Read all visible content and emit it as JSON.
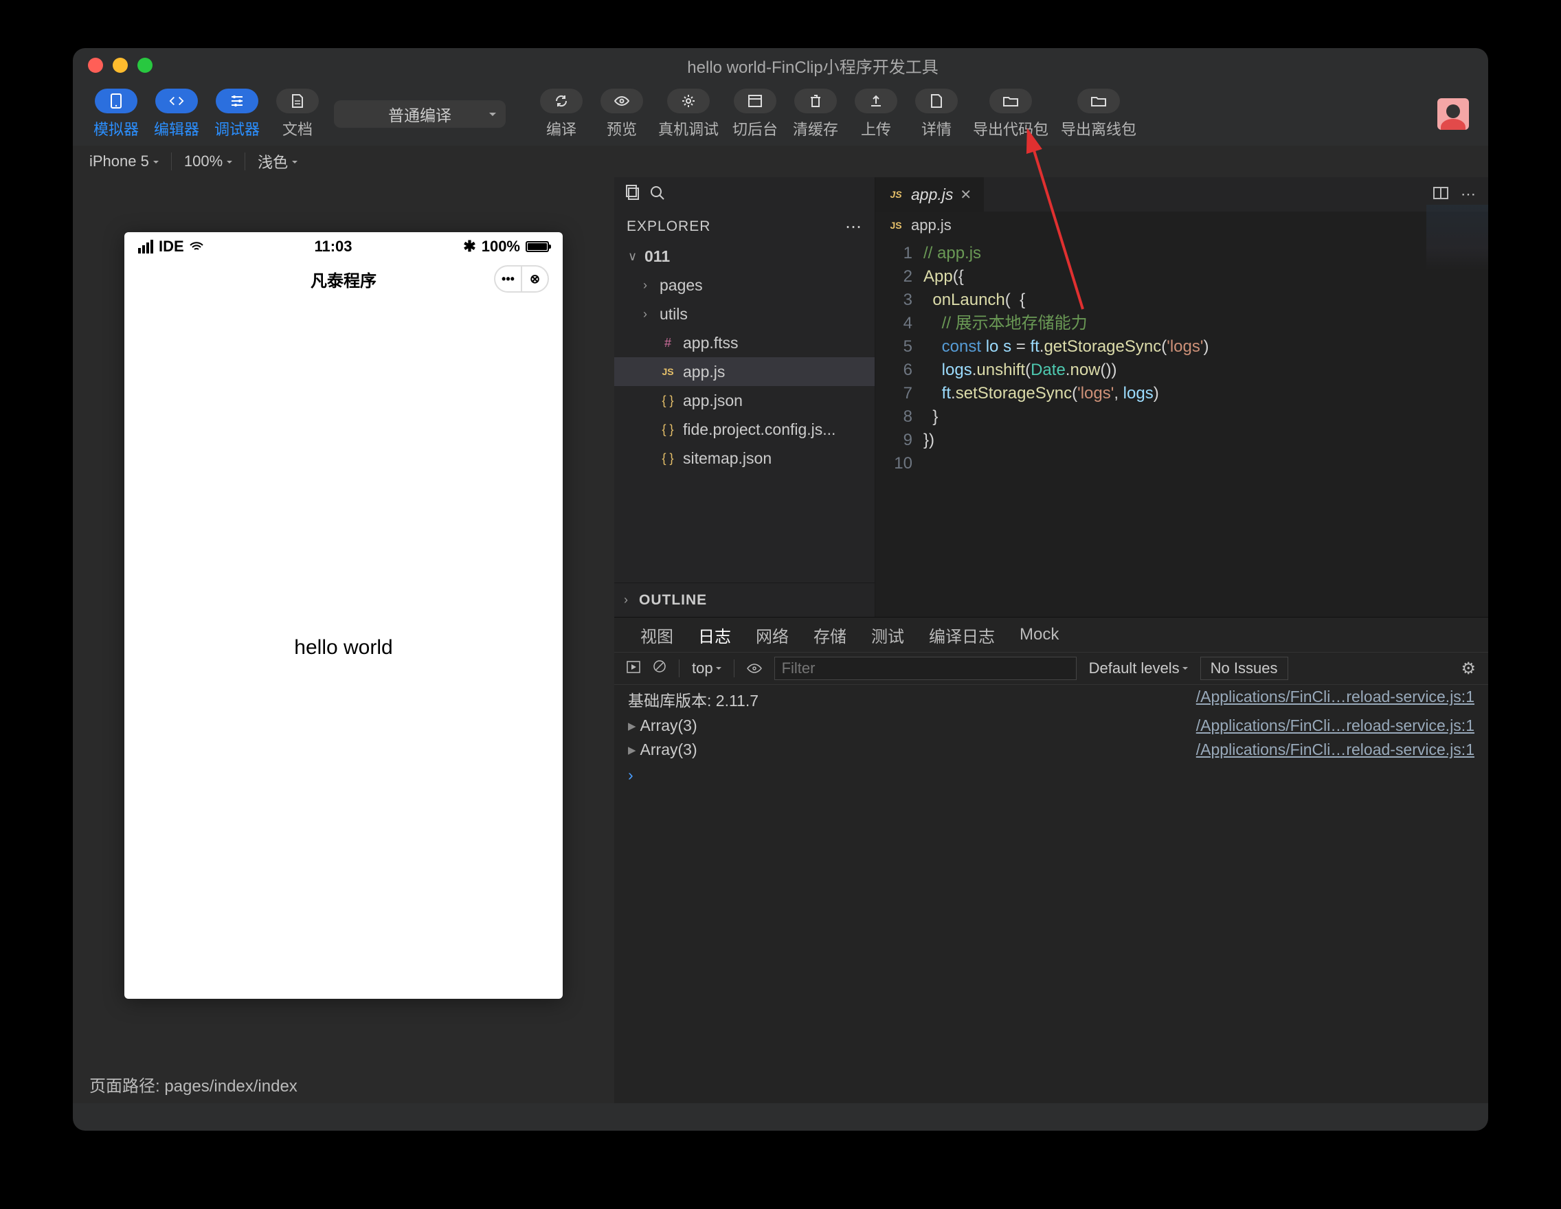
{
  "title": "hello world-FinClip小程序开发工具",
  "toolbar": {
    "simulator": "模拟器",
    "editor": "编辑器",
    "debugger": "调试器",
    "docs": "文档",
    "compileMode": "普通编译",
    "compile": "编译",
    "preview": "预览",
    "realDevice": "真机调试",
    "background": "切后台",
    "clearCache": "清缓存",
    "upload": "上传",
    "details": "详情",
    "exportCode": "导出代码包",
    "exportOffline": "导出离线包"
  },
  "subbar": {
    "device": "iPhone 5",
    "zoom": "100%",
    "theme": "浅色"
  },
  "phone": {
    "carrier": "IDE",
    "time": "11:03",
    "battery": "100%",
    "navTitle": "凡泰程序",
    "body": "hello world",
    "pagePath": "页面路径: pages/index/index"
  },
  "explorer": {
    "title": "EXPLORER",
    "root": "011",
    "items": [
      {
        "icon": ">",
        "label": "pages",
        "type": "folder"
      },
      {
        "icon": ">",
        "label": "utils",
        "type": "folder"
      },
      {
        "icon": "ft",
        "label": "app.ftss",
        "type": "ft"
      },
      {
        "icon": "JS",
        "label": "app.js",
        "type": "js",
        "selected": true
      },
      {
        "icon": "{}",
        "label": "app.json",
        "type": "jb"
      },
      {
        "icon": "{}",
        "label": "fide.project.config.js...",
        "type": "jb"
      },
      {
        "icon": "{}",
        "label": "sitemap.json",
        "type": "jb"
      }
    ],
    "outline": "OUTLINE"
  },
  "editorTab": {
    "icon": "JS",
    "name": "app.js"
  },
  "breadcrumb": {
    "icon": "JS",
    "name": "app.js"
  },
  "code": {
    "lines": [
      {
        "n": 1,
        "html": "<span class='tok-c'>// app.js</span>"
      },
      {
        "n": 2,
        "html": "<span class='tok-f'>App</span>({"
      },
      {
        "n": 3,
        "html": "  <span class='tok-f'>onLaunch</span>(  {"
      },
      {
        "n": 4,
        "html": "    <span class='tok-c'>// 展示本地存储能力</span>"
      },
      {
        "n": 5,
        "html": "    <span class='tok-k'>const</span> <span class='tok-v'>lo</span> <span class='tok-v'>s</span> = <span class='tok-v'>ft</span>.<span class='tok-f'>getStorageSync</span>(<span class='tok-s'>'logs'</span>)"
      },
      {
        "n": 6,
        "html": "    <span class='tok-v'>logs</span>.<span class='tok-f'>unshift</span>(<span class='tok-t'>Date</span>.<span class='tok-f'>now</span>())"
      },
      {
        "n": 7,
        "html": "    <span class='tok-v'>ft</span>.<span class='tok-f'>setStorageSync</span>(<span class='tok-s'>'logs'</span>, <span class='tok-v'>logs</span>)"
      },
      {
        "n": 8,
        "html": "  }"
      },
      {
        "n": 9,
        "html": "})"
      },
      {
        "n": 10,
        "html": ""
      }
    ]
  },
  "devtools": {
    "tabs": [
      "视图",
      "日志",
      "网络",
      "存储",
      "测试",
      "编译日志",
      "Mock"
    ],
    "activeTab": "日志",
    "scope": "top",
    "filter_ph": "Filter",
    "levels": "Default levels",
    "issues": "No Issues",
    "rows": [
      {
        "l": "基础库版本: 2.11.7",
        "r": "/Applications/FinCli…reload-service.js:1"
      },
      {
        "l": "Array(3)",
        "r": "/Applications/FinCli…reload-service.js:1",
        "exp": true
      },
      {
        "l": "Array(3)",
        "r": "/Applications/FinCli…reload-service.js:1",
        "exp": true
      }
    ]
  }
}
